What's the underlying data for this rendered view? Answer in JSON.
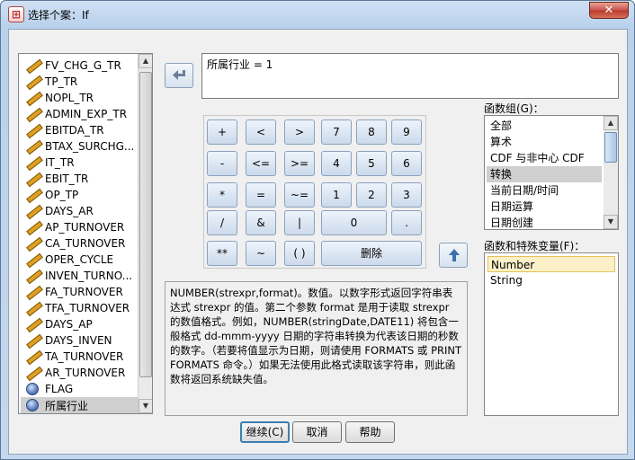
{
  "window": {
    "title": "选择个案：If",
    "app_icon": "spss-icon",
    "close_label": "✕"
  },
  "variables": {
    "items": [
      {
        "label": "FV_CHG_G_TR",
        "icon": "scale-variable-icon"
      },
      {
        "label": "TP_TR",
        "icon": "scale-variable-icon"
      },
      {
        "label": "NOPL_TR",
        "icon": "scale-variable-icon"
      },
      {
        "label": "ADMIN_EXP_TR",
        "icon": "scale-variable-icon"
      },
      {
        "label": "EBITDA_TR",
        "icon": "scale-variable-icon"
      },
      {
        "label": "BTAX_SURCHG...",
        "icon": "scale-variable-icon"
      },
      {
        "label": "IT_TR",
        "icon": "scale-variable-icon"
      },
      {
        "label": "EBIT_TR",
        "icon": "scale-variable-icon"
      },
      {
        "label": "OP_TP",
        "icon": "scale-variable-icon"
      },
      {
        "label": "DAYS_AR",
        "icon": "scale-variable-icon"
      },
      {
        "label": "AP_TURNOVER",
        "icon": "scale-variable-icon"
      },
      {
        "label": "CA_TURNOVER",
        "icon": "scale-variable-icon"
      },
      {
        "label": "OPER_CYCLE",
        "icon": "scale-variable-icon"
      },
      {
        "label": "INVEN_TURNO...",
        "icon": "scale-variable-icon"
      },
      {
        "label": "FA_TURNOVER",
        "icon": "scale-variable-icon"
      },
      {
        "label": "TFA_TURNOVER",
        "icon": "scale-variable-icon"
      },
      {
        "label": "DAYS_AP",
        "icon": "scale-variable-icon"
      },
      {
        "label": "DAYS_INVEN",
        "icon": "scale-variable-icon"
      },
      {
        "label": "TA_TURNOVER",
        "icon": "scale-variable-icon"
      },
      {
        "label": "AR_TURNOVER",
        "icon": "scale-variable-icon"
      },
      {
        "label": "FLAG",
        "icon": "nominal-variable-icon"
      },
      {
        "label": "所属行业",
        "icon": "nominal-variable-icon",
        "selected": true
      }
    ]
  },
  "expression": {
    "value": "所属行业 = 1"
  },
  "keypad": {
    "keys": [
      "+",
      "<",
      ">",
      "7",
      "8",
      "9",
      "-",
      "<=",
      ">=",
      "4",
      "5",
      "6",
      "*",
      "=",
      "~=",
      "1",
      "2",
      "3",
      "/",
      "&",
      "|",
      "0",
      ".",
      "**",
      "~",
      "( )",
      "删除"
    ]
  },
  "description": {
    "text": "NUMBER(strexpr,format)。数值。以数字形式返回字符串表达式 strexpr 的值。第二个参数 format 是用于读取 strexpr 的数值格式。例如，NUMBER(stringDate,DATE11) 将包含一般格式 dd-mmm-yyyy 日期的字符串转换为代表该日期的秒数的数字。（若要将值显示为日期，则请使用 FORMATS 或 PRINT FORMATS 命令。）如果无法使用此格式读取该字符串，则此函数将返回系统缺失值。"
  },
  "function_group": {
    "label": "函数组(G)：",
    "items": [
      "全部",
      "算术",
      "CDF 与非中心 CDF",
      "转换",
      "当前日期/时间",
      "日期运算",
      "日期创建"
    ],
    "selected": "转换"
  },
  "functions": {
    "label": "函数和特殊变量(F)：",
    "items": [
      "Number",
      "String"
    ],
    "selected": "Number"
  },
  "buttons": {
    "continue": "继续(C)",
    "cancel": "取消",
    "help": "帮助"
  },
  "colors": {
    "accent": "#3c7fb1",
    "selection": "#cfcfcf",
    "func_selection": "#fbf0c8"
  }
}
